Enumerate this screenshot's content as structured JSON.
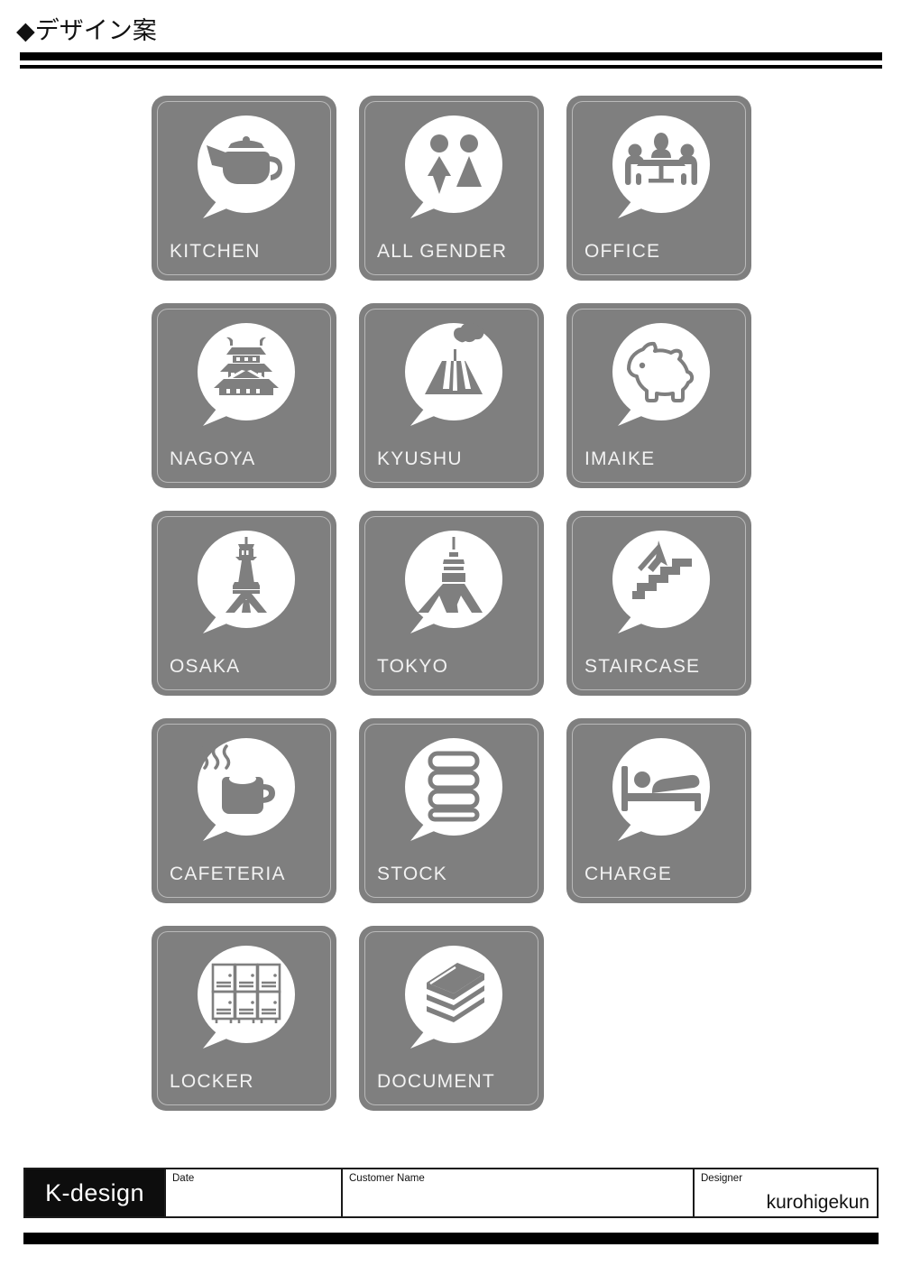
{
  "header": {
    "bullet": "◆",
    "title": "デザイン案"
  },
  "colors": {
    "tile_fill": "#7f7f7f",
    "tile_inner_border": "#b9b9b9",
    "bubble_fill": "#ffffff",
    "label_text": "#f2f2f2",
    "rule": "#000000",
    "brand_block": "#0d0d0d"
  },
  "tiles": [
    {
      "label": "KITCHEN",
      "icon": "teapot-icon"
    },
    {
      "label": "ALL GENDER",
      "icon": "all-gender-restroom-icon"
    },
    {
      "label": "OFFICE",
      "icon": "meeting-table-icon"
    },
    {
      "label": "NAGOYA",
      "icon": "nagoya-castle-icon"
    },
    {
      "label": "KYUSHU",
      "icon": "volcano-icon"
    },
    {
      "label": "IMAIKE",
      "icon": "pig-icon"
    },
    {
      "label": "OSAKA",
      "icon": "tsutenkaku-tower-icon"
    },
    {
      "label": "TOKYO",
      "icon": "tokyo-tower-icon"
    },
    {
      "label": "STAIRCASE",
      "icon": "stairs-up-arrow-icon"
    },
    {
      "label": "CAFETERIA",
      "icon": "coffee-mug-icon"
    },
    {
      "label": "STOCK",
      "icon": "stacked-boxes-icon"
    },
    {
      "label": "CHARGE",
      "icon": "person-in-bed-icon"
    },
    {
      "label": "LOCKER",
      "icon": "lockers-icon"
    },
    {
      "label": "DOCUMENT",
      "icon": "book-stack-icon"
    }
  ],
  "footer": {
    "brand": "K-design",
    "date_caption": "Date",
    "date_value": "",
    "customer_caption": "Customer Name",
    "customer_value": "",
    "designer_caption": "Designer",
    "designer_value": "kurohigekun"
  }
}
